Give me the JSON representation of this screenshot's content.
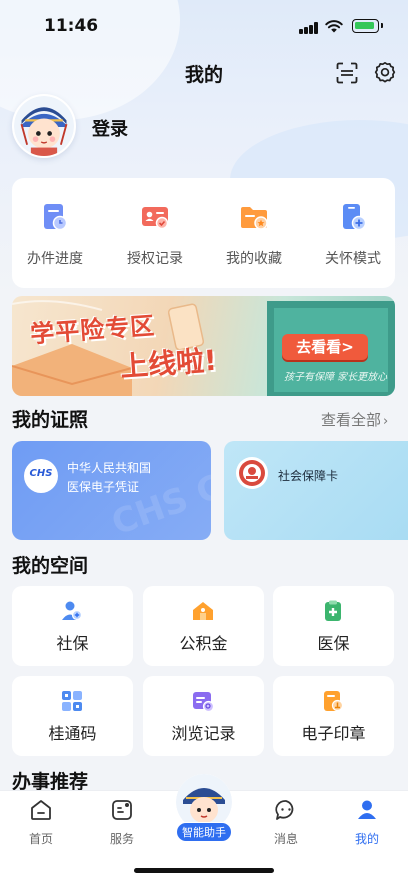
{
  "status_bar": {
    "time": "11:46"
  },
  "header": {
    "title": "我的"
  },
  "profile": {
    "login_label": "登录"
  },
  "quick_actions": [
    {
      "label": "办件进度",
      "icon": "progress-doc-icon"
    },
    {
      "label": "授权记录",
      "icon": "authorization-card-icon"
    },
    {
      "label": "我的收藏",
      "icon": "folder-star-icon"
    },
    {
      "label": "关怀模式",
      "icon": "care-mode-icon"
    }
  ],
  "banner": {
    "headline_1": "学平险专区",
    "headline_2": "上线啦!",
    "cta": "去看看>",
    "slogan": "孩子有保障 家长更放心"
  },
  "certificates": {
    "title": "我的证照",
    "view_all": "查看全部",
    "items": [
      {
        "logo_text": "CHS",
        "line1": "中华人民共和国",
        "line2": "医保电子凭证"
      },
      {
        "name": "社会保障卡"
      }
    ]
  },
  "my_space": {
    "title": "我的空间",
    "items": [
      {
        "label": "社保",
        "icon": "social-security-icon"
      },
      {
        "label": "公积金",
        "icon": "housing-fund-icon"
      },
      {
        "label": "医保",
        "icon": "medical-insurance-icon"
      },
      {
        "label": "桂通码",
        "icon": "qr-code-icon"
      },
      {
        "label": "浏览记录",
        "icon": "browse-history-icon"
      },
      {
        "label": "电子印章",
        "icon": "e-seal-icon"
      }
    ]
  },
  "recommend": {
    "title": "办事推荐"
  },
  "tabbar": {
    "items": [
      {
        "label": "首页"
      },
      {
        "label": "服务"
      },
      {
        "label": "消息"
      },
      {
        "label": "我的"
      }
    ],
    "assistant_label": "智能助手"
  },
  "colors": {
    "accent": "#2f6ef0",
    "cert_blue": "#6f9cf4",
    "cert_cyan": "#bfe6f7",
    "icon_orange": "#ff9b3d"
  }
}
